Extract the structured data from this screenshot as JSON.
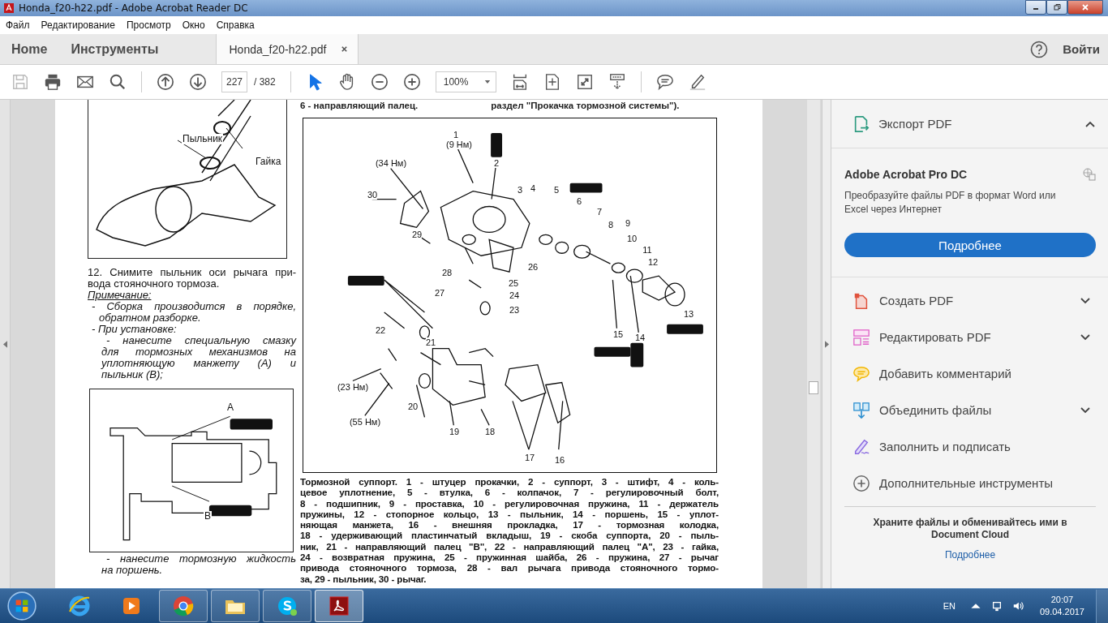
{
  "window": {
    "title": "Honda_f20-h22.pdf - Adobe Acrobat Reader DC"
  },
  "menu": [
    "Файл",
    "Редактирование",
    "Просмотр",
    "Окно",
    "Справка"
  ],
  "tabs": [
    {
      "label": "Home",
      "kind": "nav",
      "selected": false
    },
    {
      "label": "Инструменты",
      "kind": "nav",
      "selected": false
    },
    {
      "label": "Honda_f20-h22.pdf",
      "kind": "document",
      "selected": true
    }
  ],
  "sign_in": "Войти",
  "toolbar": {
    "page": "227",
    "page_total": "/ 382",
    "zoom": "100%",
    "pointer_tools": [
      {
        "kind": "select",
        "selected": true
      },
      {
        "kind": "hand",
        "selected": false
      }
    ]
  },
  "page": {
    "top_left": "6 - направляющий палец.",
    "top_right": "раздел \"Прокачка тормозной системы\").",
    "figure_1_labels": [
      "Пыльник",
      "Гайка"
    ],
    "step_lines": [
      "12. Снимите пыльник оси рычага при-",
      "вода стояночного тормоза."
    ],
    "note_title": "Примечание:",
    "notes": [
      {
        "lines": [
          "- Сборка производится в порядке,",
          "обратном разборке."
        ]
      },
      {
        "lines": [
          "- При установке:"
        ],
        "children": [
          {
            "lines": [
              "- нанесите специальную смазку",
              "для тормозных механизмов на",
              "уплотняющую манжету (A) и",
              "пыльник (B);"
            ]
          }
        ]
      }
    ],
    "figure_2_labels": [
      "A",
      "B"
    ],
    "after_figure_note": [
      "- нанесите тормозную жидкость",
      "на поршень."
    ],
    "diagram_callouts": [
      "1",
      "(9 Нм)",
      "2",
      "(34 Нм)",
      "30",
      "3",
      "4",
      "5",
      "6",
      "7",
      "8",
      "9",
      "10",
      "11",
      "12",
      "13",
      "14",
      "15",
      "29",
      "26",
      "28",
      "25",
      "27",
      "24",
      "23",
      "22",
      "21",
      "(23 Нм)",
      "20",
      "19",
      "18",
      "(55 Нм)",
      "17",
      "16"
    ],
    "caption_lines": [
      "Тормозной суппорт. 1 - штуцер прокачки, 2 - суппорт, 3 - штифт, 4 - коль-",
      "цевое уплотнение, 5 - втулка, 6 - колпачок, 7 - регулировочный болт,",
      "8 - подшипник, 9 - проставка, 10 - регулировочная пружина, 11 - держатель",
      "пружины, 12 - стопорное кольцо, 13 - пыльник, 14 - поршень, 15 - уплот-",
      "няющая манжета, 16 - внешняя прокладка, 17 - тормозная колодка,",
      "18 - удерживающий пластинчатый вкладыш, 19 - скоба суппорта, 20 - пыль-",
      "ник, 21 - направляющий палец \"В\", 22 - направляющий палец \"А\", 23 - гайка,",
      "24 - возвратная пружина, 25 - пружинная шайба, 26 - пружина, 27 - рычаг",
      "привода стояночного тормоза, 28 - вал рычага привода стояночного тормо-",
      "за, 29 - пыльник, 30 - рычаг."
    ]
  },
  "side_panel": {
    "export": {
      "label": "Экспорт PDF",
      "expanded": true,
      "product": "Adobe Acrobat Pro DC",
      "description": "Преобразуйте файлы PDF в формат Word или Excel через Интернет",
      "button": "Подробнее"
    },
    "tools": [
      {
        "kind": "create",
        "label": "Создать PDF",
        "has_menu": true
      },
      {
        "kind": "edit",
        "label": "Редактировать PDF",
        "has_menu": true
      },
      {
        "kind": "comment",
        "label": "Добавить комментарий",
        "has_menu": false
      },
      {
        "kind": "combine",
        "label": "Объединить файлы",
        "has_menu": true
      },
      {
        "kind": "sign",
        "label": "Заполнить и подписать",
        "has_menu": false
      },
      {
        "kind": "more",
        "label": "Дополнительные инструменты",
        "has_menu": false
      }
    ],
    "cloud": {
      "text": "Храните файлы и обменивайтесь ими в Document Cloud",
      "link": "Подробнее"
    }
  },
  "taskbar": {
    "apps": [
      {
        "kind": "ie",
        "open": false,
        "selected": false
      },
      {
        "kind": "media",
        "open": false,
        "selected": false
      },
      {
        "kind": "chrome",
        "open": true,
        "selected": false
      },
      {
        "kind": "explorer",
        "open": true,
        "selected": false
      },
      {
        "kind": "skype",
        "open": true,
        "selected": false
      },
      {
        "kind": "acrobat",
        "open": true,
        "selected": true
      }
    ],
    "language": "EN",
    "time": "20:07",
    "date": "09.04.2017"
  }
}
